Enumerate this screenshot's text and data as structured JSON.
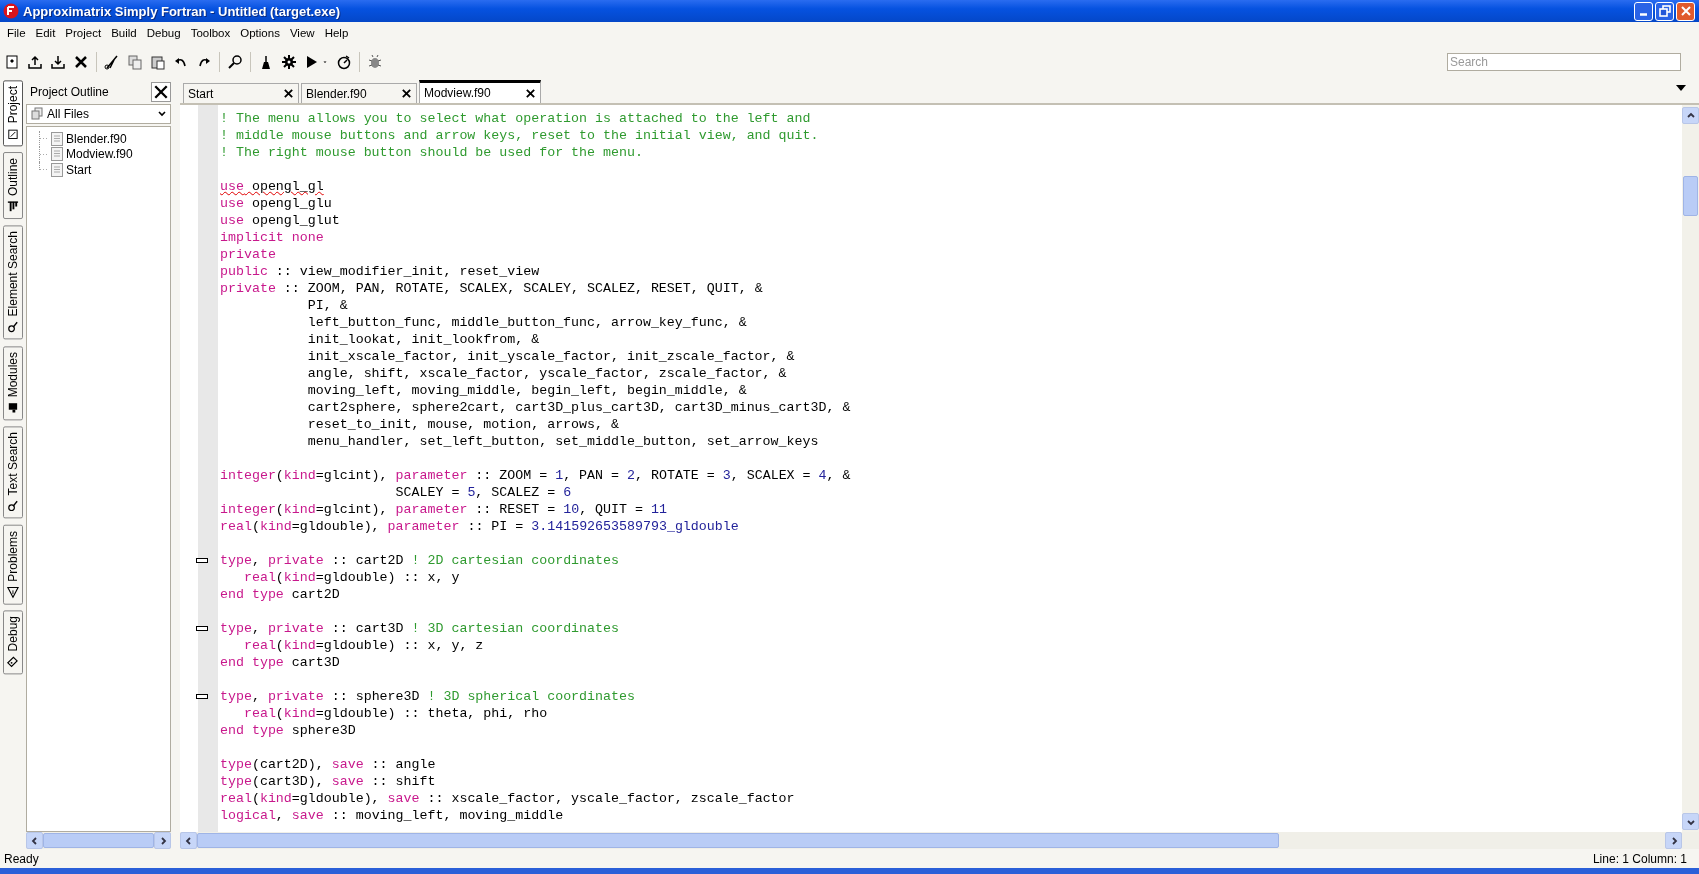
{
  "window": {
    "title": "Approximatrix Simply Fortran - Untitled (target.exe)"
  },
  "menu": [
    "File",
    "Edit",
    "Project",
    "Build",
    "Debug",
    "Toolbox",
    "Options",
    "View",
    "Help"
  ],
  "search": {
    "placeholder": "Search"
  },
  "side_tabs": [
    {
      "label": "Project",
      "selected": true
    },
    {
      "label": "Outline",
      "selected": false
    },
    {
      "label": "Element Search",
      "selected": false
    },
    {
      "label": "Modules",
      "selected": false
    },
    {
      "label": "Text Search",
      "selected": false
    },
    {
      "label": "Problems",
      "selected": false
    },
    {
      "label": "Debug",
      "selected": false
    }
  ],
  "project_panel": {
    "title": "Project Outline",
    "filter": "All Files",
    "files": [
      "Blender.f90",
      "Modview.f90",
      "Start"
    ]
  },
  "editor_tabs": [
    {
      "label": "Start",
      "selected": false
    },
    {
      "label": "Blender.f90",
      "selected": false
    },
    {
      "label": "Modview.f90",
      "selected": true
    }
  ],
  "code": {
    "lines": [
      {
        "fold_marker": false,
        "misspelled": false,
        "tokens": [
          {
            "kind": "comment",
            "text": "! The menu allows you to select what operation is attached to the left and"
          }
        ]
      },
      {
        "fold_marker": false,
        "misspelled": false,
        "tokens": [
          {
            "kind": "comment",
            "text": "! middle mouse buttons and arrow keys, reset to the initial view, and quit."
          }
        ]
      },
      {
        "fold_marker": false,
        "misspelled": false,
        "tokens": [
          {
            "kind": "comment",
            "text": "! The right mouse button should be used for the menu."
          }
        ]
      },
      {
        "fold_marker": false,
        "misspelled": false
      },
      {
        "fold_marker": false,
        "misspelled": true,
        "tokens": [
          {
            "kind": "keyword",
            "text": "use"
          },
          {
            "kind": "plain",
            "text": " opengl_gl"
          }
        ]
      },
      {
        "fold_marker": false,
        "misspelled": false,
        "tokens": [
          {
            "kind": "keyword",
            "text": "use"
          },
          {
            "kind": "plain",
            "text": " opengl_glu"
          }
        ]
      },
      {
        "fold_marker": false,
        "misspelled": false,
        "tokens": [
          {
            "kind": "keyword",
            "text": "use"
          },
          {
            "kind": "plain",
            "text": " opengl_glut"
          }
        ]
      },
      {
        "fold_marker": false,
        "misspelled": false,
        "tokens": [
          {
            "kind": "keyword",
            "text": "implicit none"
          }
        ]
      },
      {
        "fold_marker": false,
        "misspelled": false,
        "tokens": [
          {
            "kind": "keyword",
            "text": "private"
          }
        ]
      },
      {
        "fold_marker": false,
        "misspelled": false,
        "tokens": [
          {
            "kind": "keyword",
            "text": "public"
          },
          {
            "kind": "plain",
            "text": " :: view_modifier_init, reset_view"
          }
        ]
      },
      {
        "fold_marker": false,
        "misspelled": false,
        "tokens": [
          {
            "kind": "keyword",
            "text": "private"
          },
          {
            "kind": "plain",
            "text": " :: ZOOM, PAN, ROTATE, SCALEX, SCALEY, SCALEZ, RESET, QUIT, &"
          }
        ]
      },
      {
        "fold_marker": false,
        "misspelled": false,
        "tokens": [
          {
            "kind": "plain",
            "text": "           PI, &"
          }
        ]
      },
      {
        "fold_marker": false,
        "misspelled": false,
        "tokens": [
          {
            "kind": "plain",
            "text": "           left_button_func, middle_button_func, arrow_key_func, &"
          }
        ]
      },
      {
        "fold_marker": false,
        "misspelled": false,
        "tokens": [
          {
            "kind": "plain",
            "text": "           init_lookat, init_lookfrom, &"
          }
        ]
      },
      {
        "fold_marker": false,
        "misspelled": false,
        "tokens": [
          {
            "kind": "plain",
            "text": "           init_xscale_factor, init_yscale_factor, init_zscale_factor, &"
          }
        ]
      },
      {
        "fold_marker": false,
        "misspelled": false,
        "tokens": [
          {
            "kind": "plain",
            "text": "           angle, shift, xscale_factor, yscale_factor, zscale_factor, &"
          }
        ]
      },
      {
        "fold_marker": false,
        "misspelled": false,
        "tokens": [
          {
            "kind": "plain",
            "text": "           moving_left, moving_middle, begin_left, begin_middle, &"
          }
        ]
      },
      {
        "fold_marker": false,
        "misspelled": false,
        "tokens": [
          {
            "kind": "plain",
            "text": "           cart2sphere, sphere2cart, cart3D_plus_cart3D, cart3D_minus_cart3D, &"
          }
        ]
      },
      {
        "fold_marker": false,
        "misspelled": false,
        "tokens": [
          {
            "kind": "plain",
            "text": "           reset_to_init, mouse, motion, arrows, &"
          }
        ]
      },
      {
        "fold_marker": false,
        "misspelled": false,
        "tokens": [
          {
            "kind": "plain",
            "text": "           menu_handler, set_left_button, set_middle_button, set_arrow_keys"
          }
        ]
      },
      {
        "fold_marker": false,
        "misspelled": false
      },
      {
        "fold_marker": false,
        "misspelled": false,
        "tokens": [
          {
            "kind": "keyword",
            "text": "integer"
          },
          {
            "kind": "plain",
            "text": "("
          },
          {
            "kind": "keyword",
            "text": "kind"
          },
          {
            "kind": "plain",
            "text": "=glcint), "
          },
          {
            "kind": "keyword",
            "text": "parameter"
          },
          {
            "kind": "plain",
            "text": " :: ZOOM = "
          },
          {
            "kind": "number",
            "text": "1"
          },
          {
            "kind": "plain",
            "text": ", PAN = "
          },
          {
            "kind": "number",
            "text": "2"
          },
          {
            "kind": "plain",
            "text": ", ROTATE = "
          },
          {
            "kind": "number",
            "text": "3"
          },
          {
            "kind": "plain",
            "text": ", SCALEX = "
          },
          {
            "kind": "number",
            "text": "4"
          },
          {
            "kind": "plain",
            "text": ", &"
          }
        ]
      },
      {
        "fold_marker": false,
        "misspelled": false,
        "tokens": [
          {
            "kind": "plain",
            "text": "                      SCALEY = "
          },
          {
            "kind": "number",
            "text": "5"
          },
          {
            "kind": "plain",
            "text": ", SCALEZ = "
          },
          {
            "kind": "number",
            "text": "6"
          }
        ]
      },
      {
        "fold_marker": false,
        "misspelled": false,
        "tokens": [
          {
            "kind": "keyword",
            "text": "integer"
          },
          {
            "kind": "plain",
            "text": "("
          },
          {
            "kind": "keyword",
            "text": "kind"
          },
          {
            "kind": "plain",
            "text": "=glcint), "
          },
          {
            "kind": "keyword",
            "text": "parameter"
          },
          {
            "kind": "plain",
            "text": " :: RESET = "
          },
          {
            "kind": "number",
            "text": "10"
          },
          {
            "kind": "plain",
            "text": ", QUIT = "
          },
          {
            "kind": "number",
            "text": "11"
          }
        ]
      },
      {
        "fold_marker": false,
        "misspelled": false,
        "tokens": [
          {
            "kind": "keyword",
            "text": "real"
          },
          {
            "kind": "plain",
            "text": "("
          },
          {
            "kind": "keyword",
            "text": "kind"
          },
          {
            "kind": "plain",
            "text": "=gldouble), "
          },
          {
            "kind": "keyword",
            "text": "parameter"
          },
          {
            "kind": "plain",
            "text": " :: PI = "
          },
          {
            "kind": "number",
            "text": "3.141592653589793_gldouble"
          }
        ]
      },
      {
        "fold_marker": false,
        "misspelled": false
      },
      {
        "fold_marker": true,
        "misspelled": false,
        "tokens": [
          {
            "kind": "keyword",
            "text": "type"
          },
          {
            "kind": "plain",
            "text": ", "
          },
          {
            "kind": "keyword",
            "text": "private"
          },
          {
            "kind": "plain",
            "text": " :: cart2D "
          },
          {
            "kind": "comment",
            "text": "! 2D cartesian coordinates"
          }
        ]
      },
      {
        "fold_marker": false,
        "misspelled": false,
        "tokens": [
          {
            "kind": "keyword",
            "text": "   real"
          },
          {
            "kind": "plain",
            "text": "("
          },
          {
            "kind": "keyword",
            "text": "kind"
          },
          {
            "kind": "plain",
            "text": "=gldouble) :: x, y"
          }
        ]
      },
      {
        "fold_marker": false,
        "misspelled": false,
        "tokens": [
          {
            "kind": "keyword",
            "text": "end type"
          },
          {
            "kind": "plain",
            "text": " cart2D"
          }
        ]
      },
      {
        "fold_marker": false,
        "misspelled": false
      },
      {
        "fold_marker": true,
        "misspelled": false,
        "tokens": [
          {
            "kind": "keyword",
            "text": "type"
          },
          {
            "kind": "plain",
            "text": ", "
          },
          {
            "kind": "keyword",
            "text": "private"
          },
          {
            "kind": "plain",
            "text": " :: cart3D "
          },
          {
            "kind": "comment",
            "text": "! 3D cartesian coordinates"
          }
        ]
      },
      {
        "fold_marker": false,
        "misspelled": false,
        "tokens": [
          {
            "kind": "keyword",
            "text": "   real"
          },
          {
            "kind": "plain",
            "text": "("
          },
          {
            "kind": "keyword",
            "text": "kind"
          },
          {
            "kind": "plain",
            "text": "=gldouble) :: x, y, z"
          }
        ]
      },
      {
        "fold_marker": false,
        "misspelled": false,
        "tokens": [
          {
            "kind": "keyword",
            "text": "end type"
          },
          {
            "kind": "plain",
            "text": " cart3D"
          }
        ]
      },
      {
        "fold_marker": false,
        "misspelled": false
      },
      {
        "fold_marker": true,
        "misspelled": false,
        "tokens": [
          {
            "kind": "keyword",
            "text": "type"
          },
          {
            "kind": "plain",
            "text": ", "
          },
          {
            "kind": "keyword",
            "text": "private"
          },
          {
            "kind": "plain",
            "text": " :: sphere3D "
          },
          {
            "kind": "comment",
            "text": "! 3D spherical coordinates"
          }
        ]
      },
      {
        "fold_marker": false,
        "misspelled": false,
        "tokens": [
          {
            "kind": "keyword",
            "text": "   real"
          },
          {
            "kind": "plain",
            "text": "("
          },
          {
            "kind": "keyword",
            "text": "kind"
          },
          {
            "kind": "plain",
            "text": "=gldouble) :: theta, phi, rho"
          }
        ]
      },
      {
        "fold_marker": false,
        "misspelled": false,
        "tokens": [
          {
            "kind": "keyword",
            "text": "end type"
          },
          {
            "kind": "plain",
            "text": " sphere3D"
          }
        ]
      },
      {
        "fold_marker": false,
        "misspelled": false
      },
      {
        "fold_marker": false,
        "misspelled": false,
        "tokens": [
          {
            "kind": "keyword",
            "text": "type"
          },
          {
            "kind": "plain",
            "text": "(cart2D), "
          },
          {
            "kind": "keyword",
            "text": "save"
          },
          {
            "kind": "plain",
            "text": " :: angle"
          }
        ]
      },
      {
        "fold_marker": false,
        "misspelled": false,
        "tokens": [
          {
            "kind": "keyword",
            "text": "type"
          },
          {
            "kind": "plain",
            "text": "(cart3D), "
          },
          {
            "kind": "keyword",
            "text": "save"
          },
          {
            "kind": "plain",
            "text": " :: shift"
          }
        ]
      },
      {
        "fold_marker": false,
        "misspelled": false,
        "tokens": [
          {
            "kind": "keyword",
            "text": "real"
          },
          {
            "kind": "plain",
            "text": "("
          },
          {
            "kind": "keyword",
            "text": "kind"
          },
          {
            "kind": "plain",
            "text": "=gldouble), "
          },
          {
            "kind": "keyword",
            "text": "save"
          },
          {
            "kind": "plain",
            "text": " :: xscale_factor, yscale_factor, zscale_factor"
          }
        ]
      },
      {
        "fold_marker": false,
        "misspelled": false,
        "tokens": [
          {
            "kind": "keyword",
            "text": "logical"
          },
          {
            "kind": "plain",
            "text": ", "
          },
          {
            "kind": "keyword",
            "text": "save"
          },
          {
            "kind": "plain",
            "text": " :: moving_left, moving_middle"
          }
        ]
      }
    ]
  },
  "status_bar": {
    "message": "Ready",
    "position": "Line: 1 Column: 1"
  }
}
